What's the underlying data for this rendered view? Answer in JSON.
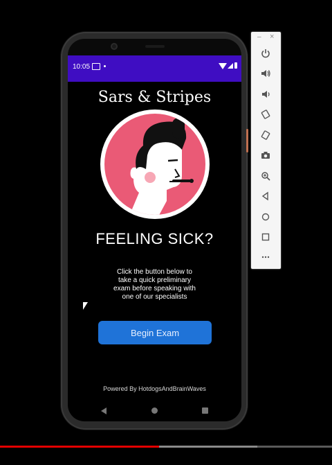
{
  "status_bar": {
    "time": "10:05"
  },
  "app": {
    "title": "Sars & Stripes",
    "headline": "FEELING SICK?",
    "description": "Click the button below to take a quick preliminary exam before speaking with one of our specialists",
    "begin_button": "Begin Exam",
    "footer": "Powered By HotdogsAndBrainWaves"
  },
  "toolbar": {
    "minimize": "–",
    "close": "×",
    "buttons": [
      "power-icon",
      "volume-up-icon",
      "volume-down-icon",
      "rotate-left-icon",
      "rotate-right-icon",
      "camera-icon",
      "zoom-icon",
      "back-icon",
      "home-icon",
      "overview-icon",
      "more-icon"
    ]
  },
  "video": {
    "progress": 0.48
  },
  "colors": {
    "status_bar": "#3f0dc2",
    "button": "#1f73d8",
    "logo_pink": "#ea5a76",
    "progress": "#e30000"
  }
}
